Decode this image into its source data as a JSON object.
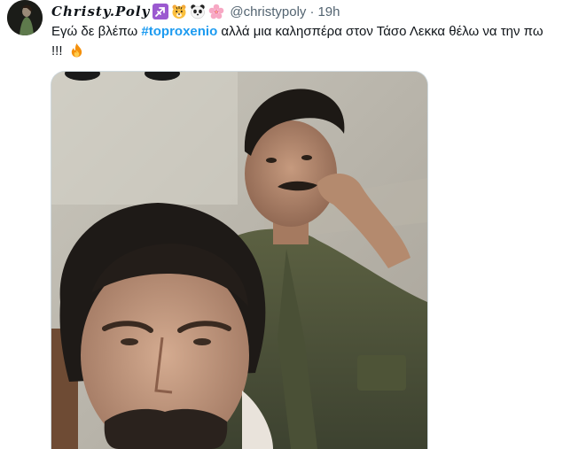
{
  "tweet": {
    "display_name": "Christy.Poly",
    "badges": [
      "sagittarius-icon",
      "tiger-face-icon",
      "panda-icon",
      "cherry-blossom-icon"
    ],
    "handle": "@christypoly",
    "separator": "·",
    "time": "19h",
    "text_before": "Εγώ δε βλέπω ",
    "hashtag": "#toproxenio",
    "text_after": " αλλά μια καλησπέρα στον Τάσο Λεκκα θέλω να την πω !!! ",
    "trailing_emoji": "fire-icon",
    "media": "photo"
  },
  "colors": {
    "hashtag": "#1d9bf0",
    "secondary_text": "#536471",
    "primary_text": "#0f1419",
    "border": "#cfd9de"
  }
}
